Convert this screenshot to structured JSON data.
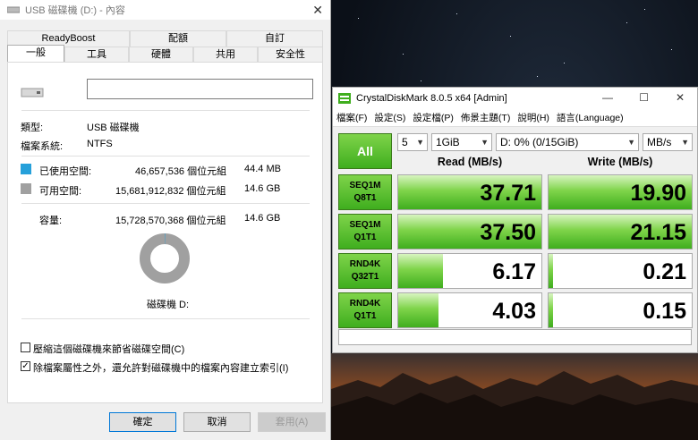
{
  "properties": {
    "title": "USB 磁碟機 (D:) - 內容",
    "tabs_row1": [
      "ReadyBoost",
      "配額",
      "自訂"
    ],
    "tabs_row2": [
      "一般",
      "工具",
      "硬體",
      "共用",
      "安全性"
    ],
    "volume_name_value": "",
    "type_label": "類型:",
    "type_value": "USB 磁碟機",
    "fs_label": "檔案系統:",
    "fs_value": "NTFS",
    "used_label": "已使用空間:",
    "used_bytes": "46,657,536 個位元組",
    "used_size": "44.4 MB",
    "free_label": "可用空間:",
    "free_bytes": "15,681,912,832 個位元組",
    "free_size": "14.6 GB",
    "capacity_label": "容量:",
    "capacity_bytes": "15,728,570,368 個位元組",
    "capacity_size": "14.6 GB",
    "used_fraction": 0.003,
    "drive_label": "磁碟機 D:",
    "compress_label": "壓縮這個磁碟機來節省磁碟空間(C)",
    "compress_checked": false,
    "index_label": "除檔案屬性之外，還允許對磁碟機中的檔案內容建立索引(I)",
    "index_checked": true,
    "ok_label": "確定",
    "cancel_label": "取消",
    "apply_label": "套用(A)",
    "used_color": "#26a0da",
    "free_color": "#a0a0a0"
  },
  "cdm": {
    "title": "CrystalDiskMark 8.0.5 x64 [Admin]",
    "menu": [
      "檔案(F)",
      "設定(S)",
      "設定檔(P)",
      "佈景主題(T)",
      "說明(H)",
      "語言(Language)"
    ],
    "all_label": "All",
    "count": "5",
    "size": "1GiB",
    "drive": "D: 0% (0/15GiB)",
    "unit": "MB/s",
    "read_header": "Read (MB/s)",
    "write_header": "Write (MB/s)",
    "rows": [
      {
        "l1": "SEQ1M",
        "l2": "Q8T1",
        "read": "37.71",
        "write": "19.90"
      },
      {
        "l1": "SEQ1M",
        "l2": "Q1T1",
        "read": "37.50",
        "write": "21.15"
      },
      {
        "l1": "RND4K",
        "l2": "Q32T1",
        "read": "6.17",
        "write": "0.21"
      },
      {
        "l1": "RND4K",
        "l2": "Q1T1",
        "read": "4.03",
        "write": "0.15"
      }
    ],
    "bar_fill": [
      {
        "read": 1.0,
        "write": 1.0
      },
      {
        "read": 1.0,
        "write": 1.0
      },
      {
        "read": 0.31,
        "write": 0.03
      },
      {
        "read": 0.28,
        "write": 0.03
      }
    ],
    "comment": "",
    "accent_color": "#3fae1e"
  }
}
